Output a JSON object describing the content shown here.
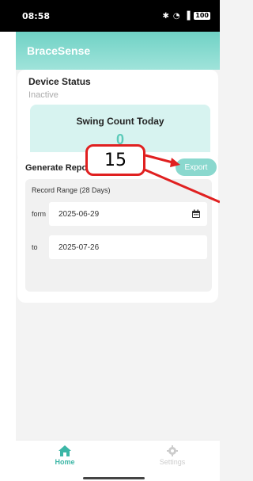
{
  "status_bar": {
    "time": "08:58",
    "battery": "100"
  },
  "app": {
    "title": "BraceSense"
  },
  "device_status": {
    "title": "Device Status",
    "state": "Inactive",
    "swing_label": "Swing Count Today",
    "swing_count": "0"
  },
  "report": {
    "title": "Generate Report",
    "export_label": "Export",
    "range_title": "Record Range (28 Days)",
    "from_label": "form",
    "from_date": "2025-06-29",
    "to_label": "to",
    "to_date": "2025-07-26"
  },
  "bottom_nav": {
    "home_label": "Home",
    "settings_label": "Settings"
  },
  "annotation": {
    "number": "15",
    "color": "#e02020"
  },
  "colors": {
    "accent": "#6fd2c5",
    "accent_dark": "#3cb6a6",
    "export": "#8ad8ce"
  }
}
